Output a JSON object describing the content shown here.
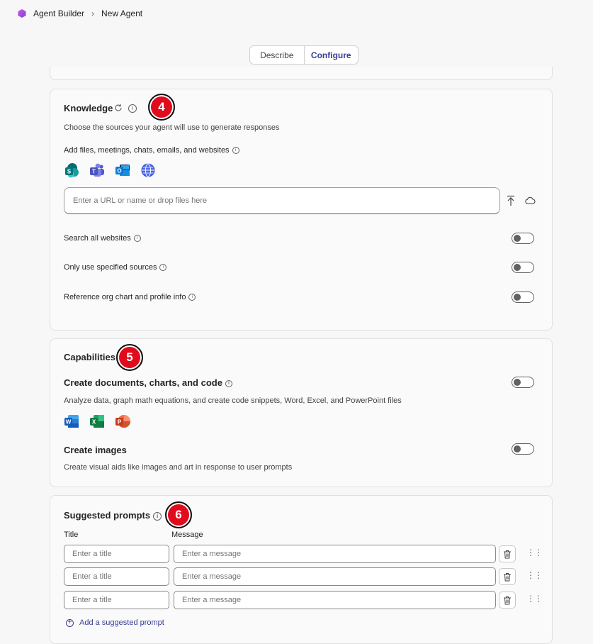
{
  "breadcrumb": {
    "app": "Agent Builder",
    "separator": "›",
    "current": "New Agent"
  },
  "tabs": [
    {
      "label": "Describe",
      "active": false
    },
    {
      "label": "Configure",
      "active": true
    }
  ],
  "colors": {
    "accent": "#383b96",
    "badge": "#e00b1c"
  },
  "knowledge": {
    "title": "Knowledge",
    "badge": "4",
    "description": "Choose the sources your agent will use to generate responses",
    "add_sources_label": "Add files, meetings, chats, emails, and websites",
    "source_icons": [
      "sharepoint-icon",
      "teams-icon",
      "outlook-icon",
      "globe-icon"
    ],
    "url_placeholder": "Enter a URL or name or drop files here",
    "toggles": [
      {
        "label": "Search all websites",
        "on": false
      },
      {
        "label": "Only use specified sources",
        "on": false
      },
      {
        "label": "Reference org chart and profile info",
        "on": false
      }
    ]
  },
  "capabilities": {
    "title": "Capabilities",
    "badge": "5",
    "documents": {
      "label": "Create documents, charts, and code",
      "description": "Analyze data, graph math equations, and create code snippets, Word, Excel, and PowerPoint files",
      "on": false,
      "icons": [
        "word-icon",
        "excel-icon",
        "powerpoint-icon"
      ]
    },
    "images": {
      "label": "Create images",
      "description": "Create visual aids like images and art in response to user prompts",
      "on": false
    }
  },
  "prompts": {
    "title": "Suggested prompts",
    "badge": "6",
    "col_title": "Title",
    "col_message": "Message",
    "title_placeholder": "Enter a title",
    "message_placeholder": "Enter a message",
    "add_label": "Add a suggested prompt"
  }
}
